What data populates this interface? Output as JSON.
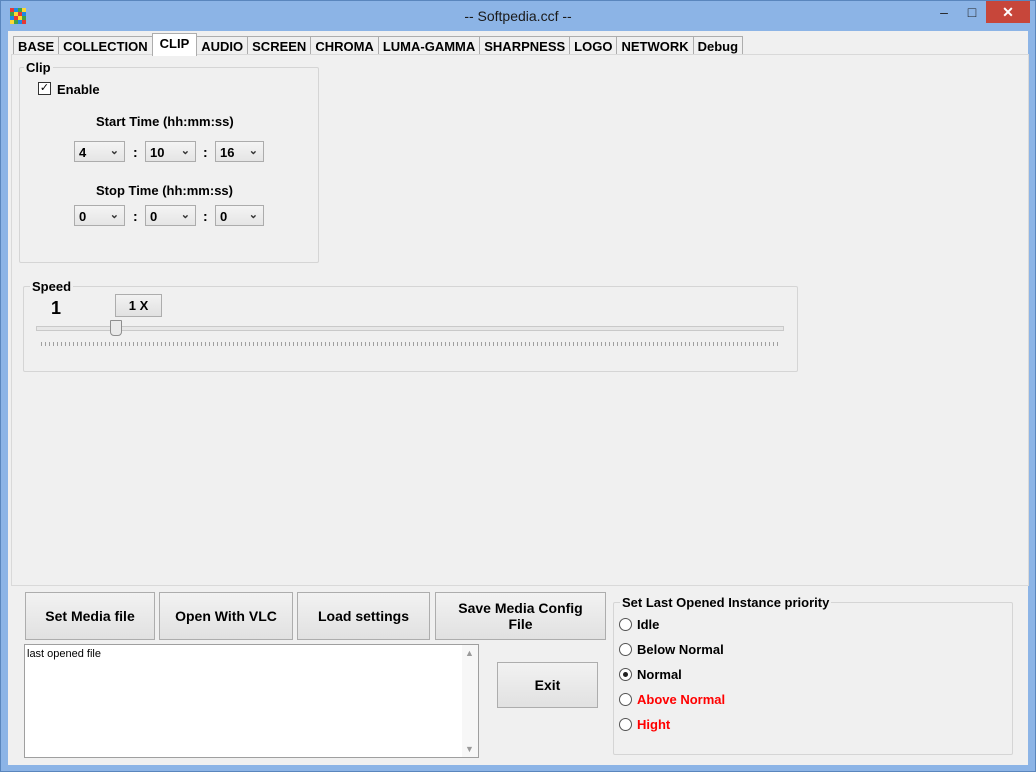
{
  "window": {
    "title": "-- Softpedia.ccf --",
    "minimize": "–",
    "maximize": "□",
    "close": "✕"
  },
  "tabs": [
    "BASE",
    "COLLECTION",
    "CLIP",
    "AUDIO",
    "SCREEN",
    "CHROMA",
    "LUMA-GAMMA",
    "SHARPNESS",
    "LOGO",
    "NETWORK",
    "Debug"
  ],
  "active_tab": "CLIP",
  "clip": {
    "legend": "Clip",
    "enable_label": "Enable",
    "enable_checked": true,
    "checkmark": "✓",
    "start_label": "Start Time (hh:mm:ss)",
    "start": {
      "hh": "4",
      "mm": "10",
      "ss": "16"
    },
    "stop_label": "Stop Time (hh:mm:ss)",
    "stop": {
      "hh": "0",
      "mm": "0",
      "ss": "0"
    },
    "separator": ":",
    "dropdown_arrow": "⌄"
  },
  "speed": {
    "legend": "Speed",
    "value": "1",
    "multiplier_button": "1 X",
    "slider_fraction": 0.1
  },
  "actions": {
    "set_media": "Set Media file",
    "open_vlc": "Open With VLC",
    "load_settings": "Load settings",
    "save_config": "Save Media Config File",
    "exit": "Exit"
  },
  "log": {
    "text": "last opened file",
    "scroll_up": "▲",
    "scroll_down": "▼"
  },
  "priority": {
    "legend": "Set Last Opened Instance priority",
    "options": [
      {
        "label": "Idle",
        "selected": false,
        "color": "#000000"
      },
      {
        "label": "Below Normal",
        "selected": false,
        "color": "#000000"
      },
      {
        "label": "Normal",
        "selected": true,
        "color": "#000000"
      },
      {
        "label": "Above Normal",
        "selected": false,
        "color": "#ff0000"
      },
      {
        "label": "Hight",
        "selected": false,
        "color": "#ff0000"
      }
    ]
  },
  "colors": {
    "close_button": "#c7463a",
    "titlebar": "#8cb4e6",
    "client": "#f0f0f0"
  }
}
